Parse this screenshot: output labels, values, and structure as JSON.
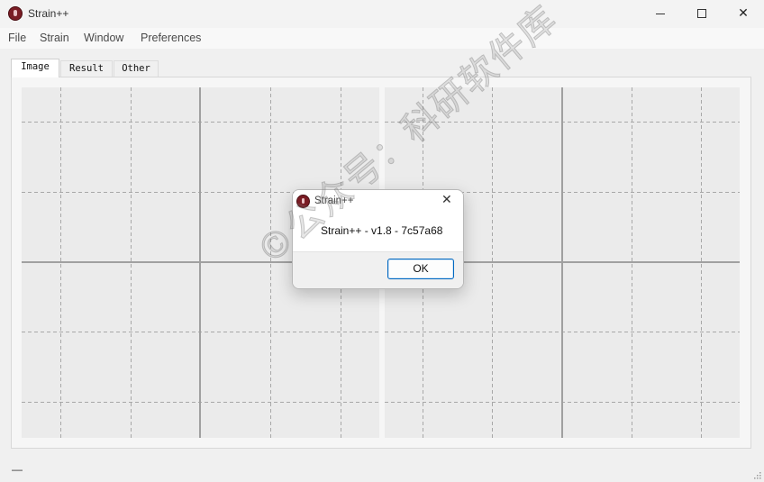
{
  "window": {
    "title": "Strain++",
    "icon": "app-logo-icon"
  },
  "menu": {
    "items": [
      "File",
      "Strain",
      "Window",
      "Preferences"
    ]
  },
  "tabs": {
    "items": [
      "Image",
      "Result",
      "Other"
    ],
    "active": "Image"
  },
  "status": {
    "text": "—"
  },
  "watermark": {
    "text": "©公众号：科研软件库"
  },
  "dialog": {
    "title": "Strain++",
    "message": "Strain++ - v1.8 - 7c57a68",
    "ok_label": "OK"
  },
  "colors": {
    "accent": "#0067c0",
    "plot_background": "#ebebeb",
    "grid_major": "#a0a0a0",
    "grid_minor": "#a8a8a8"
  }
}
